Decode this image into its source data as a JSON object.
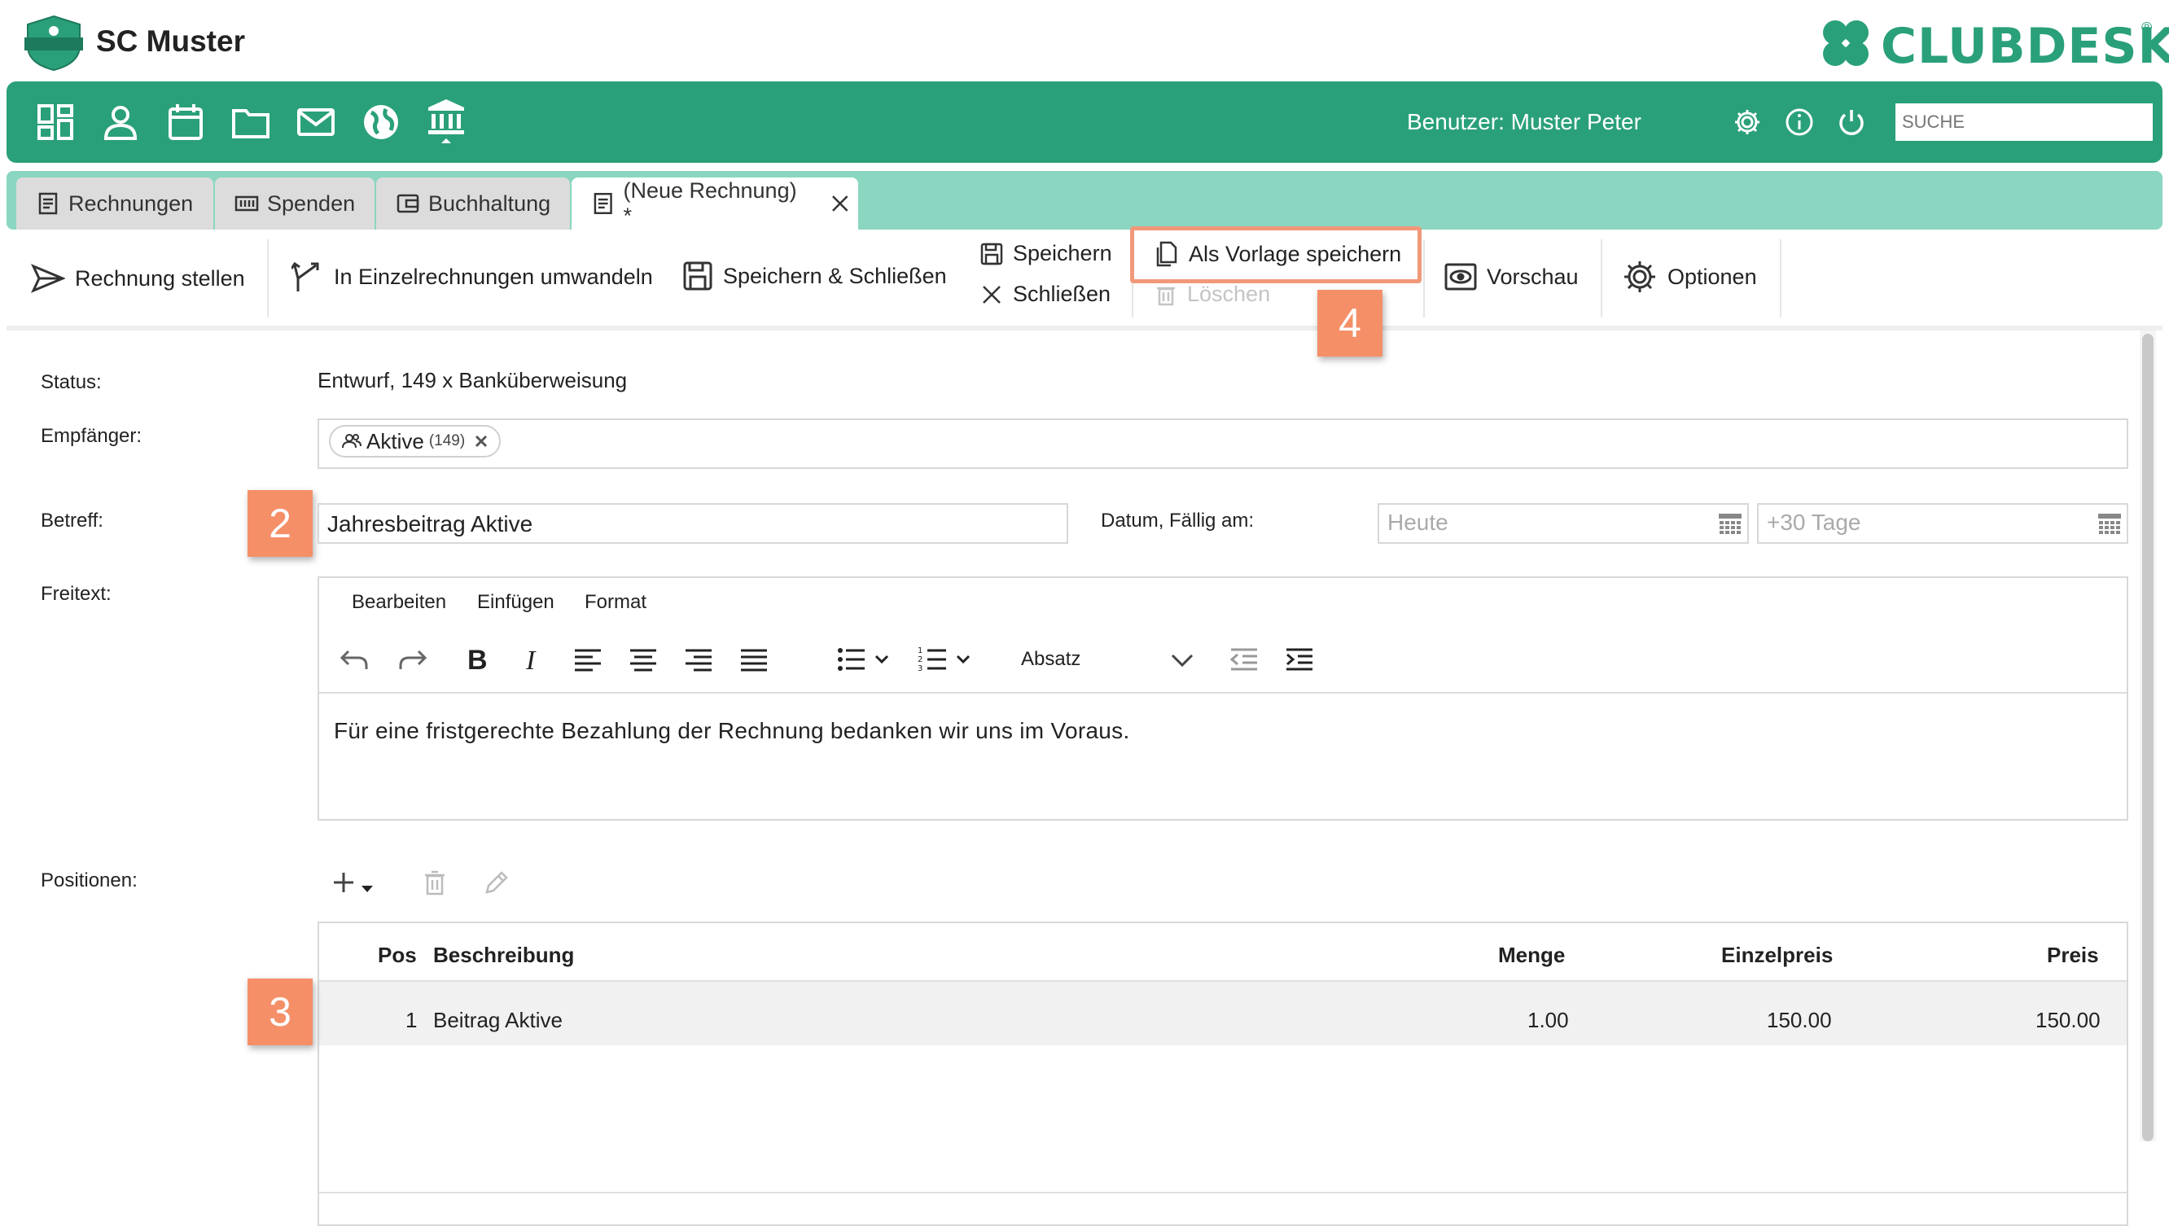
{
  "brand": {
    "name": "SC Muster",
    "logo_text": "SC MUSTER",
    "product": "CLUBDESK",
    "registered": "®"
  },
  "colors": {
    "primary": "#2aa07a",
    "tabbar": "#8ad6c1",
    "highlight": "#f58f68"
  },
  "nav": {
    "icons": [
      "dashboard-icon",
      "person-icon",
      "calendar-icon",
      "folder-icon",
      "mail-icon",
      "globe-icon",
      "bank-icon"
    ],
    "user_label": "Benutzer: Muster Peter",
    "search_placeholder": "SUCHE"
  },
  "tabs": [
    {
      "label": "Rechnungen",
      "icon": "invoice-icon"
    },
    {
      "label": "Spenden",
      "icon": "donation-icon"
    },
    {
      "label": "Buchhaltung",
      "icon": "accounting-icon"
    },
    {
      "label": "(Neue Rechnung) *",
      "icon": "invoice-icon",
      "active": true
    }
  ],
  "toolbar": {
    "issue": "Rechnung stellen",
    "split": "In Einzelrechnungen umwandeln",
    "save_close": "Speichern & Schließen",
    "save": "Speichern",
    "close": "Schließen",
    "save_template": "Als Vorlage speichern",
    "delete": "Löschen",
    "preview": "Vorschau",
    "options": "Optionen"
  },
  "badges": {
    "b2": "2",
    "b3": "3",
    "b4": "4"
  },
  "form": {
    "status_label": "Status:",
    "status_value": "Entwurf, 149 x Banküberweisung",
    "recipient_label": "Empfänger:",
    "recipient_chip": "Aktive",
    "recipient_count": "(149)",
    "subject_label": "Betreff:",
    "subject_value": "Jahresbeitrag Aktive",
    "date_label": "Datum, Fällig am:",
    "date_placeholder": "Heute",
    "due_placeholder": "+30 Tage",
    "text_label": "Freitext:",
    "positions_label": "Positionen:"
  },
  "editor": {
    "menu": [
      "Bearbeiten",
      "Einfügen",
      "Format"
    ],
    "block_format": "Absatz",
    "body": "Für eine fristgerechte Bezahlung der Rechnung bedanken wir uns im Voraus."
  },
  "table": {
    "headers": {
      "pos": "Pos",
      "desc": "Beschreibung",
      "qty": "Menge",
      "unit": "Einzelpreis",
      "price": "Preis"
    },
    "rows": [
      {
        "pos": "1",
        "desc": "Beitrag Aktive",
        "qty": "1.00",
        "unit": "150.00",
        "price": "150.00"
      }
    ]
  }
}
